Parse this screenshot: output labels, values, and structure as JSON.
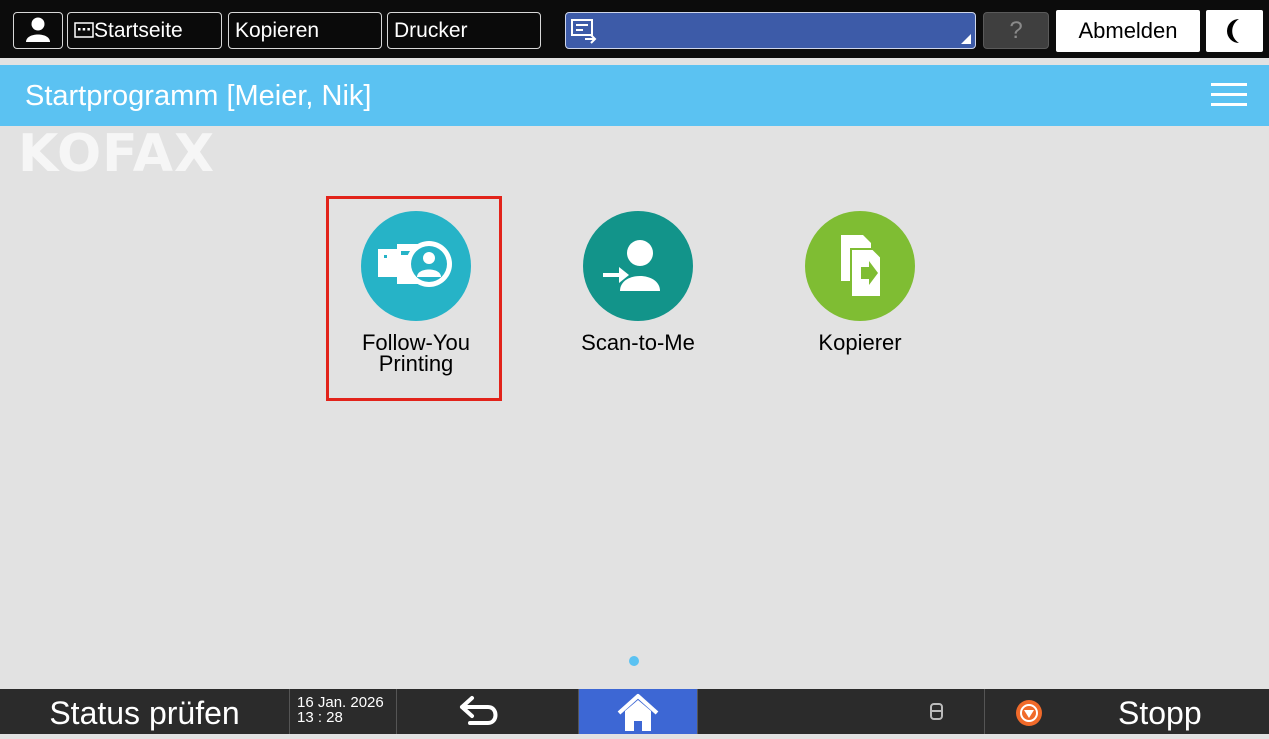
{
  "topbar": {
    "startseite_label": "Startseite",
    "kopieren_label": "Kopieren",
    "drucker_label": "Drucker",
    "help_label": "?",
    "abmelden_label": "Abmelden"
  },
  "header": {
    "title": "Startprogramm [Meier, Nik]",
    "logo": "KOFAX"
  },
  "apps": [
    {
      "label": "Follow-You\nPrinting",
      "icon": "follow-you-printing-icon",
      "color": "#26b3c7"
    },
    {
      "label": "Scan-to-Me",
      "icon": "scan-to-me-icon",
      "color": "#12948a"
    },
    {
      "label": "Kopierer",
      "icon": "copier-icon",
      "color": "#7fbd33"
    }
  ],
  "bottombar": {
    "status_label": "Status prüfen",
    "date": "16 Jan. 2026",
    "time": "13 : 28",
    "stop_label": "Stopp"
  },
  "colors": {
    "title_bar": "#5bc2f2",
    "home_button": "#3d67d4",
    "highlight": "#e2231a"
  }
}
